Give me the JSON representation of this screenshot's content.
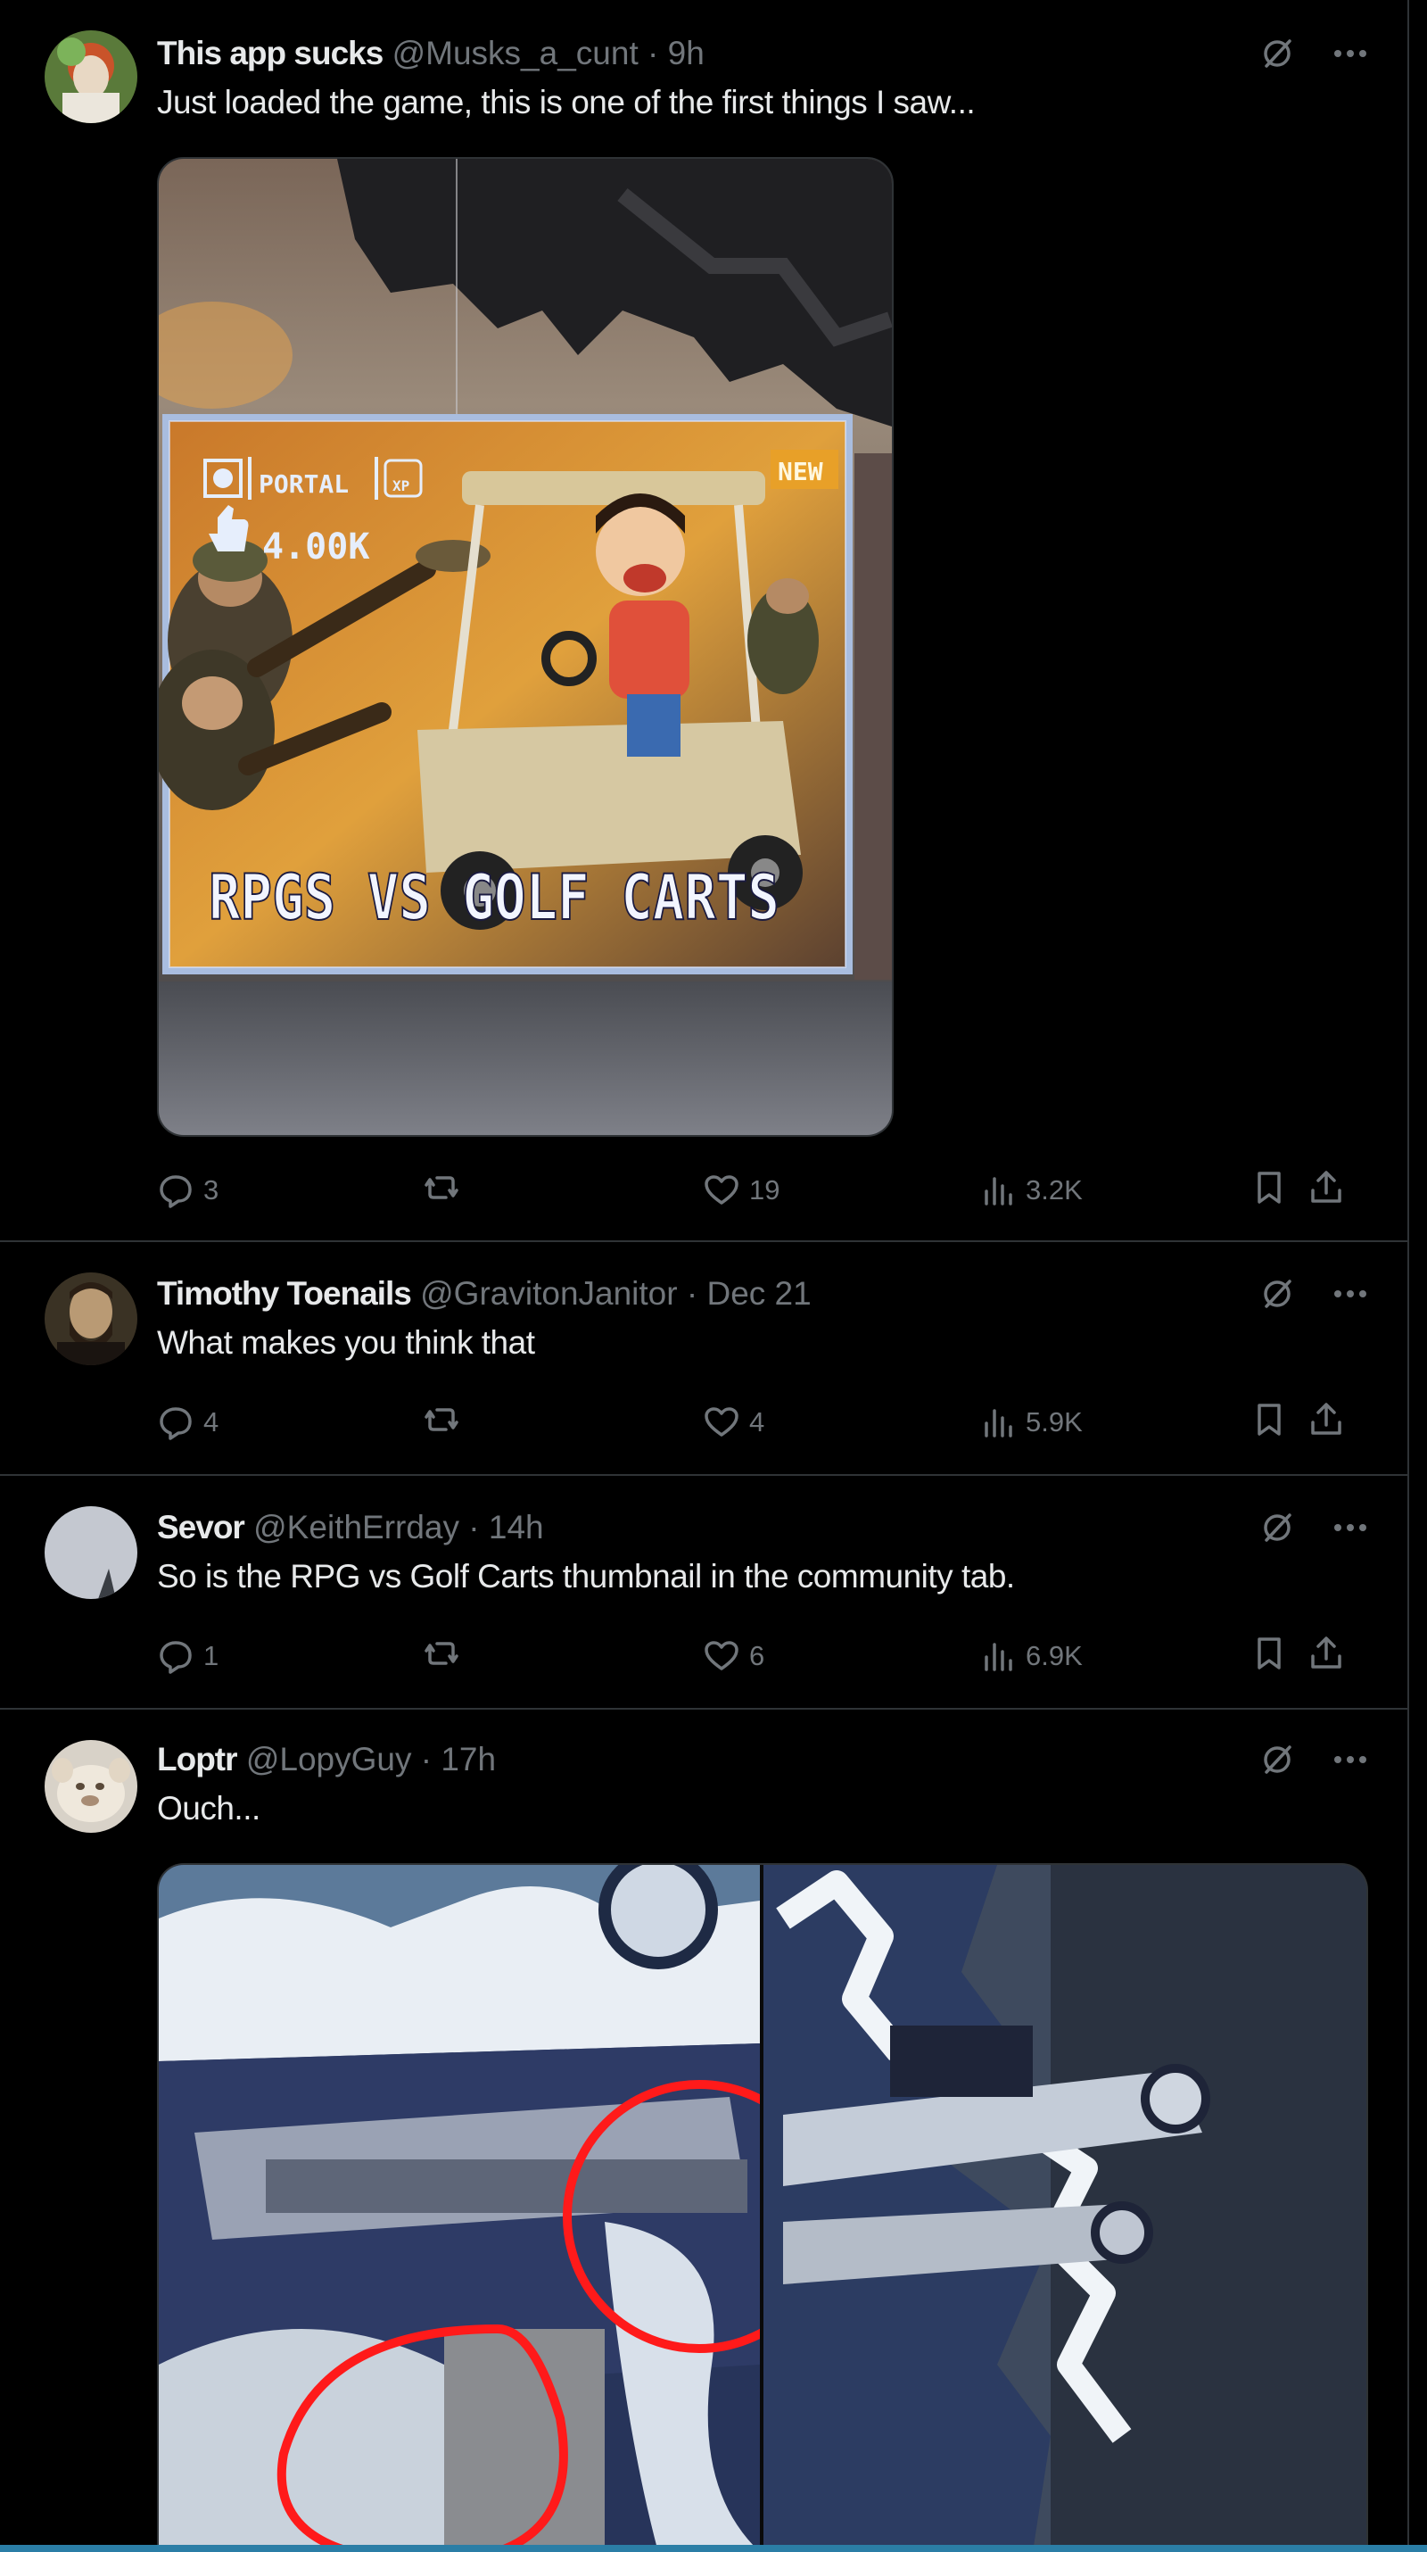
{
  "posts": [
    {
      "name": "This app sucks",
      "handle": "@Musks_a_cunt",
      "dot": "·",
      "time": "9h",
      "text": "Just loaded the game, this is one of the first things I saw...",
      "media": {
        "badge_new": "NEW",
        "portal_label": "PORTAL",
        "xp_label": "XP",
        "likes_label": "4.00K",
        "title": "RPGS VS GOLF CARTS"
      },
      "actions": {
        "replies": "3",
        "reposts": "",
        "likes": "19",
        "views": "3.2K"
      }
    },
    {
      "name": "Timothy Toenails",
      "handle": "@GravitonJanitor",
      "dot": "·",
      "time": "Dec 21",
      "text": "What makes you think that",
      "actions": {
        "replies": "4",
        "reposts": "",
        "likes": "4",
        "views": "5.9K"
      }
    },
    {
      "name": "Sevor",
      "handle": "@KeithErrday",
      "dot": "·",
      "time": "14h",
      "text": "So is the RPG vs Golf Carts thumbnail in the community tab.",
      "actions": {
        "replies": "1",
        "reposts": "",
        "likes": "6",
        "views": "6.9K"
      }
    },
    {
      "name": "Loptr",
      "handle": "@LopyGuy",
      "dot": "·",
      "time": "17h",
      "text": "Ouch...",
      "actions": {}
    }
  ],
  "icons": {
    "reply": "reply-icon",
    "repost": "repost-icon",
    "like": "heart-icon",
    "views": "views-icon",
    "bookmark": "bookmark-icon",
    "share": "share-icon",
    "grok": "grok-icon",
    "more": "more-icon"
  },
  "colors": {
    "background": "#000000",
    "text": "#e7e9ea",
    "muted": "#71767b",
    "border": "#2f3336",
    "annotation_red": "#ff1a1a"
  }
}
